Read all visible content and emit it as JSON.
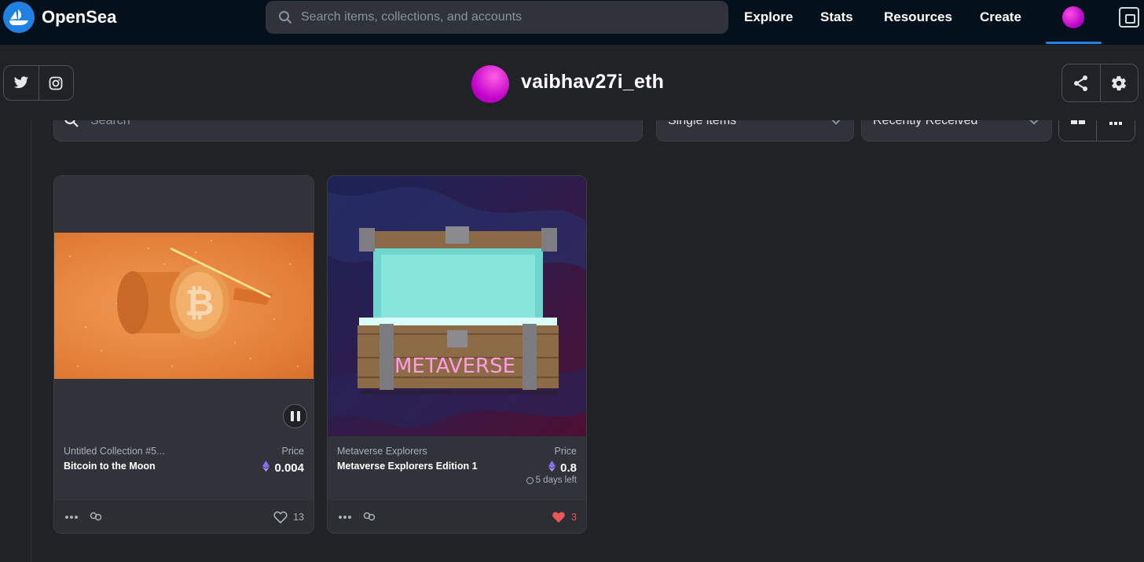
{
  "brand": {
    "name": "OpenSea"
  },
  "search": {
    "placeholder": "Search items, collections, and accounts"
  },
  "nav": {
    "explore": "Explore",
    "stats": "Stats",
    "resources": "Resources",
    "create": "Create"
  },
  "profile": {
    "username": "vaibhav27i_eth"
  },
  "filters": {
    "search_placeholder": "Search",
    "item_type": "Single items",
    "sort": "Recently Received"
  },
  "cards": [
    {
      "collection": "Untitled Collection #5...",
      "title": "Bitcoin to the Moon",
      "price_label": "Price",
      "price": "0.004",
      "likes": "13",
      "liked": false
    },
    {
      "collection": "Metaverse Explorers",
      "title": "Metaverse Explorers Edition 1",
      "price_label": "Price",
      "price": "0.8",
      "time_left": "5 days left",
      "art_text": "METAVERSE",
      "likes": "3",
      "liked": true
    }
  ],
  "colors": {
    "accent": "#2081e2",
    "nav_bg": "#04111d",
    "page_bg": "#202225",
    "card_bg": "#303339",
    "like_red": "#eb5757"
  }
}
